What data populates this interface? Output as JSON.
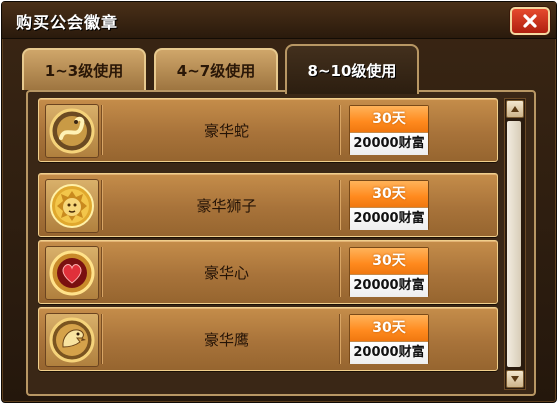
{
  "window": {
    "title": "购买公会徽章"
  },
  "tabs": [
    {
      "label": "1~3级使用",
      "active": false
    },
    {
      "label": "4~7级使用",
      "active": false
    },
    {
      "label": "8~10级使用",
      "active": true
    }
  ],
  "items": [
    {
      "name": "豪华蛇",
      "duration": "30天",
      "cost": "20000财富",
      "icon": "snake-emblem-icon"
    },
    {
      "name": "豪华狮子",
      "duration": "30天",
      "cost": "20000财富",
      "icon": "lion-emblem-icon"
    },
    {
      "name": "豪华心",
      "duration": "30天",
      "cost": "20000财富",
      "icon": "heart-emblem-icon"
    },
    {
      "name": "豪华鹰",
      "duration": "30天",
      "cost": "20000财富",
      "icon": "eagle-emblem-icon"
    }
  ],
  "colors": {
    "duration_orange": "#ff8a1e",
    "row_bronze": "#a8733a",
    "close_red": "#c8301a"
  }
}
